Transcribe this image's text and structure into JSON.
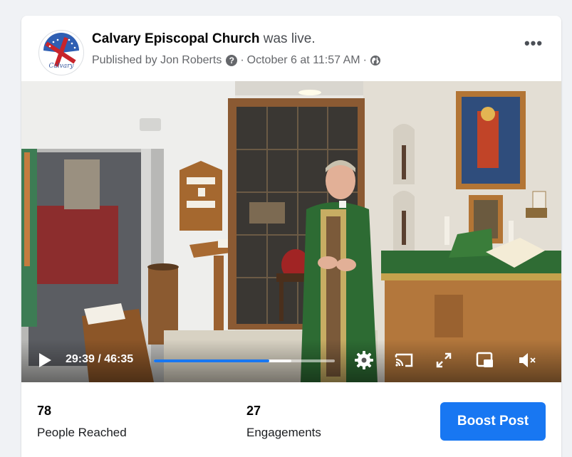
{
  "post": {
    "author": "Calvary Episcopal Church",
    "status_suffix": "was live.",
    "published_prefix": "Published by Jon Roberts",
    "date": "October 6 at 11:57 AM",
    "separator": "·",
    "more_label": "•••",
    "avatar_text": "Calvary"
  },
  "video": {
    "current_time": "29:39",
    "duration": "46:35",
    "time_display": "29:39 / 46:35",
    "progress_fraction": 0.636,
    "buffered_fraction": 0.76,
    "controls": [
      "play-icon",
      "settings-icon",
      "cast-icon",
      "fullscreen-icon",
      "picture-in-picture-icon",
      "mute-icon"
    ]
  },
  "insights": {
    "reach_value": "78",
    "reach_label": "People Reached",
    "engagement_value": "27",
    "engagement_label": "Engagements",
    "boost_label": "Boost Post"
  },
  "colors": {
    "accent": "#1877f2",
    "page_bg": "#f0f2f5",
    "text_secondary": "#65676b"
  }
}
